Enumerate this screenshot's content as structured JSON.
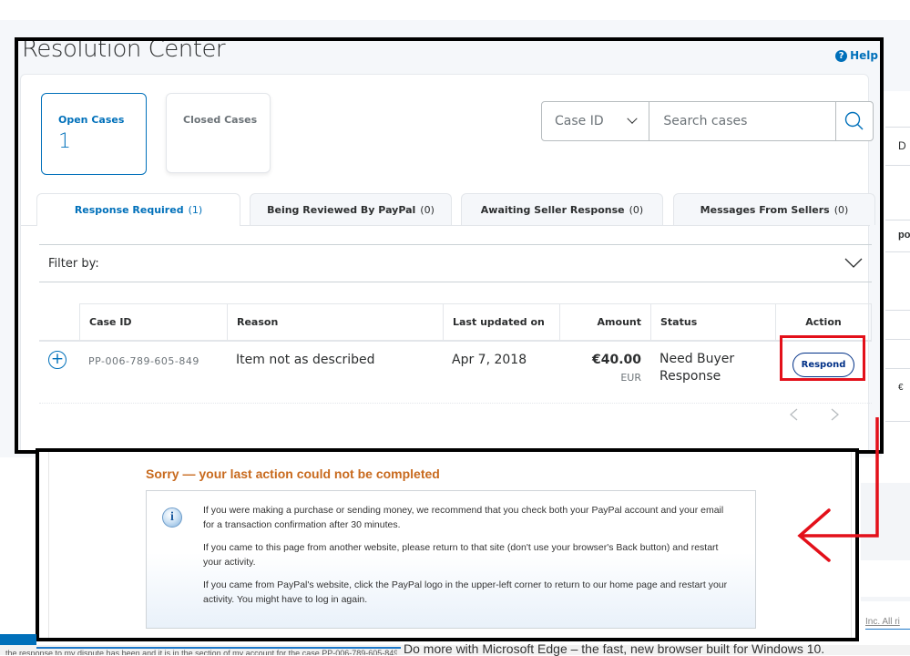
{
  "page": {
    "title": "Resolution Center",
    "help_label": "Help",
    "help_icon": "question-circle-icon"
  },
  "case_tiles": [
    {
      "label": "Open Cases",
      "count": "1",
      "active": true
    },
    {
      "label": "Closed Cases",
      "count": "",
      "active": false
    }
  ],
  "search": {
    "select_value": "Case ID",
    "placeholder": "Search cases",
    "value": "",
    "button_icon": "search-icon"
  },
  "tabs": [
    {
      "label": "Response Required",
      "count": "(1)",
      "active": true
    },
    {
      "label": "Being Reviewed By PayPal",
      "count": "(0)",
      "active": false
    },
    {
      "label": "Awaiting Seller Response",
      "count": "(0)",
      "active": false
    },
    {
      "label": "Messages From Sellers",
      "count": "(0)",
      "active": false
    }
  ],
  "filter": {
    "label": "Filter by:",
    "icon": "chevron-down-icon"
  },
  "table": {
    "columns": [
      "Case ID",
      "Reason",
      "Last updated on",
      "Amount",
      "Status",
      "Action"
    ],
    "rows": [
      {
        "case_id": "PP-006-789-605-849",
        "reason": "Item not as described",
        "last_updated": "Apr 7, 2018",
        "amount": "€40.00",
        "currency": "EUR",
        "status": "Need Buyer Response",
        "action": "Respond"
      }
    ]
  },
  "pager": {
    "prev_icon": "chevron-left-icon",
    "next_icon": "chevron-right-icon"
  },
  "error": {
    "title": "Sorry — your last action could not be completed",
    "icon": "info-icon",
    "paragraphs": [
      "If you were making a purchase or sending money, we recommend that you check both your PayPal account and your email for a transaction confirmation after 30 minutes.",
      "If you came to this page from another website, please return to that site (don't use your browser's Back button) and restart your activity.",
      "If you came from PayPal's website, click the PayPal logo in the upper-left corner to return to our home page and restart your activity. You might have to log in again."
    ]
  },
  "background": {
    "right_edge_texts": [
      "D",
      "po",
      "€"
    ],
    "copyright_fragment": "Inc. All ri",
    "edge_promo": "Do more with Microsoft Edge – the fast, new browser built for Windows 10.",
    "status_fragment": "the response to my dispute has been and it is in the section of my account for the case PP-006-789-605-849"
  },
  "annotation_colors": {
    "highlight": "#e3101a",
    "frame": "#000000",
    "accent": "#0070ba",
    "error_title": "#c86a1e"
  }
}
